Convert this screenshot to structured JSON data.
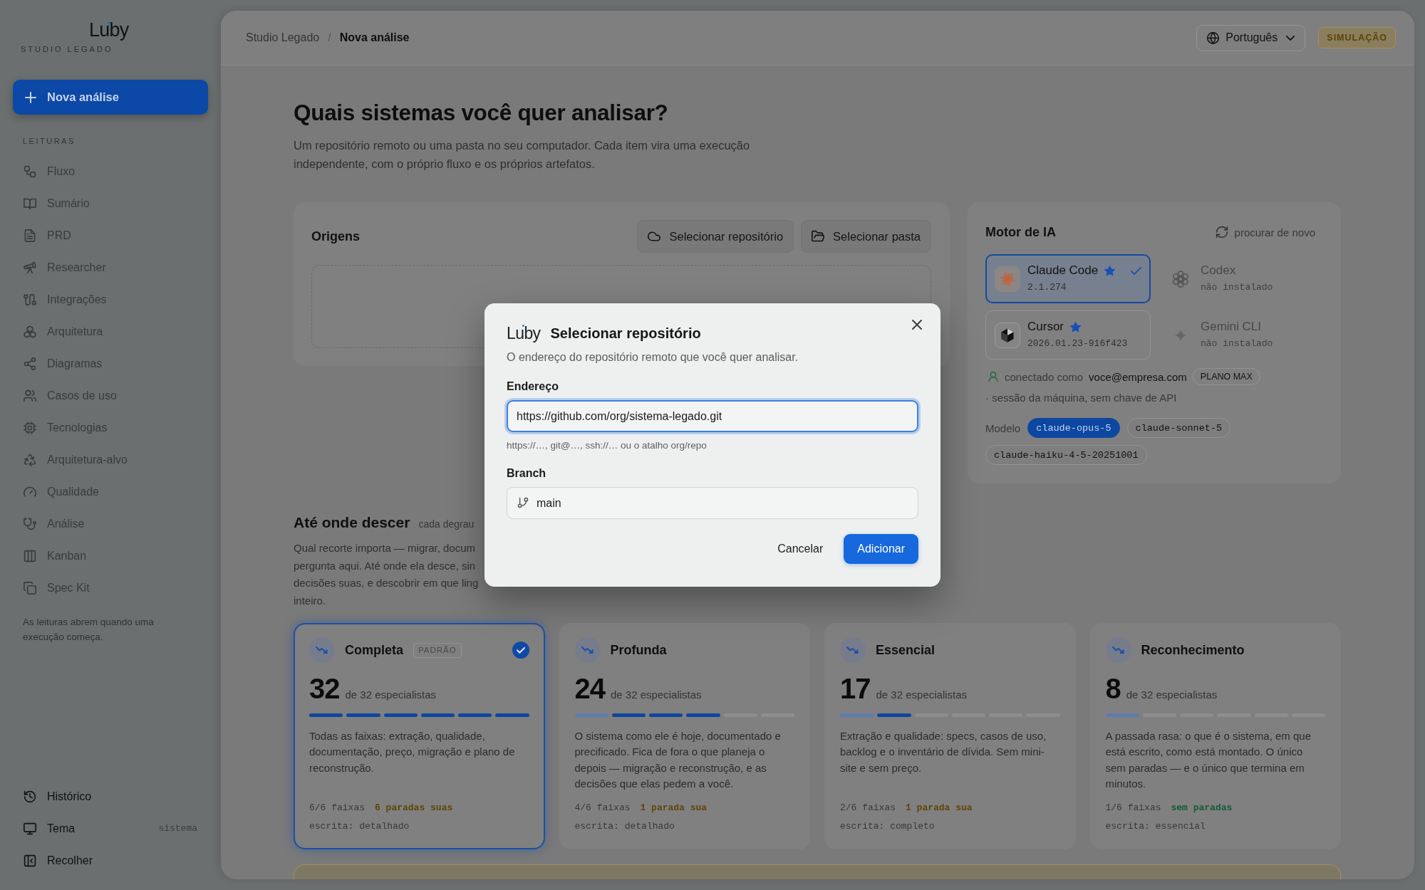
{
  "sidebar": {
    "logo": "Luby",
    "subtitle": "STUDIO LEGADO",
    "new_button": "Nova análise",
    "section_label": "LEITURAS",
    "items": [
      {
        "label": "Fluxo",
        "disabled": true
      },
      {
        "label": "Sumário",
        "disabled": true
      },
      {
        "label": "PRD",
        "disabled": true
      },
      {
        "label": "Researcher",
        "disabled": true
      },
      {
        "label": "Integrações",
        "disabled": true
      },
      {
        "label": "Arquitetura",
        "disabled": true
      },
      {
        "label": "Diagramas",
        "disabled": true
      },
      {
        "label": "Casos de uso",
        "disabled": true
      },
      {
        "label": "Tecnologias",
        "disabled": true
      },
      {
        "label": "Arquitetura-alvo",
        "disabled": true
      },
      {
        "label": "Qualidade",
        "disabled": true
      },
      {
        "label": "Análise",
        "disabled": true
      },
      {
        "label": "Kanban",
        "disabled": true
      },
      {
        "label": "Spec Kit",
        "disabled": true
      }
    ],
    "note": "As leituras abrem quando uma execução começa.",
    "footer_items": [
      {
        "label": "Histórico"
      },
      {
        "label": "Tema",
        "value": "sistema"
      },
      {
        "label": "Recolher"
      }
    ]
  },
  "header": {
    "breadcrumb": [
      {
        "label": "Studio Legado",
        "current": false
      },
      {
        "label": "Nova análise",
        "current": true
      }
    ],
    "separator": "/",
    "language": "Português",
    "mode_badge": "SIMULAÇÃO"
  },
  "intro": {
    "title": "Quais sistemas você quer analisar?",
    "description": "Um repositório remoto ou uma pasta no seu computador. Cada item vira uma execução independente, com o próprio fluxo e os próprios artefatos."
  },
  "origins": {
    "title": "Origens",
    "buttons": [
      "Selecionar repositório",
      "Selecionar pasta"
    ]
  },
  "engine": {
    "title": "Motor de IA",
    "rescan": "procurar de novo",
    "engines": [
      {
        "name": "Claude Code",
        "detail": "2.1.274",
        "installed": true,
        "starred": true,
        "selected": true
      },
      {
        "name": "Codex",
        "detail": "não instalado",
        "installed": false,
        "starred": false,
        "selected": false
      },
      {
        "name": "Cursor",
        "detail": "2026.01.23-916f423",
        "installed": true,
        "starred": true,
        "selected": false
      },
      {
        "name": "Gemini CLI",
        "detail": "não instalado",
        "installed": false,
        "starred": false,
        "selected": false
      }
    ],
    "account": {
      "prefix": "conectado como",
      "email": "voce@empresa.com",
      "plan": "PLANO MAX",
      "note": "· sessão da máquina, sem chave de API"
    },
    "model_label": "Modelo",
    "models": [
      {
        "name": "claude-opus-5",
        "selected": true
      },
      {
        "name": "claude-sonnet-5",
        "selected": false
      },
      {
        "name": "claude-haiku-4-5-20251001",
        "selected": false
      }
    ]
  },
  "depth": {
    "title": "Até onde descer",
    "hint": "cada degrau",
    "description_lines": [
      "Qual recorte importa — migrar, docum",
      "pergunta aqui. Até onde ela desce, sin",
      "decisões suas, e descobrir em que ling",
      "inteiro."
    ],
    "levels": [
      {
        "name": "Completa",
        "badge": "PADRÃO",
        "selected": true,
        "count": "32",
        "total": "de 32 especialistas",
        "segments": [
          {
            "color": "#0f469f"
          },
          {
            "color": "#0f469f"
          },
          {
            "color": "#0f469f"
          },
          {
            "color": "#0f469f"
          },
          {
            "color": "#0f469f"
          },
          {
            "color": "#0f469f"
          }
        ],
        "description": "Todas as faixas: extração, qualidade, documentação, preço, migração e plano de reconstrução.",
        "lanes": "6/6 faixas",
        "stops": {
          "text": "6 paradas suas",
          "color": "#5e4508"
        },
        "writing": "escrita: detalhado"
      },
      {
        "name": "Profunda",
        "selected": false,
        "count": "24",
        "total": "de 32 especialistas",
        "segments": [
          {
            "color": "#5d7cad"
          },
          {
            "color": "#0f469f"
          },
          {
            "color": "#0f469f"
          },
          {
            "color": "#0f469f"
          },
          {
            "color": "#8e8e8e"
          },
          {
            "color": "#8e8e8e"
          }
        ],
        "description": "O sistema como ele é hoje, documentado e precificado. Fica de fora o que planeja o depois — migração e reconstrução, e as decisões que elas pedem a você.",
        "lanes": "4/6 faixas",
        "stops": {
          "text": "1 parada sua",
          "color": "#5e4508"
        },
        "writing": "escrita: detalhado"
      },
      {
        "name": "Essencial",
        "selected": false,
        "count": "17",
        "total": "de 32 especialistas",
        "segments": [
          {
            "color": "#5d7cad"
          },
          {
            "color": "#0f469f"
          },
          {
            "color": "#8e8e8e"
          },
          {
            "color": "#8e8e8e"
          },
          {
            "color": "#8e8e8e"
          },
          {
            "color": "#8e8e8e"
          }
        ],
        "description": "Extração e qualidade: specs, casos de uso, backlog e o inventário de dívida. Sem mini-site e sem preço.",
        "lanes": "2/6 faixas",
        "stops": {
          "text": "1 parada sua",
          "color": "#5e4508"
        },
        "writing": "escrita: completo"
      },
      {
        "name": "Reconhecimento",
        "selected": false,
        "count": "8",
        "total": "de 32 especialistas",
        "segments": [
          {
            "color": "#5d7cad"
          },
          {
            "color": "#8e8e8e"
          },
          {
            "color": "#8e8e8e"
          },
          {
            "color": "#8e8e8e"
          },
          {
            "color": "#8e8e8e"
          },
          {
            "color": "#8e8e8e"
          }
        ],
        "description": "A passada rasa: o que é o sistema, em que está escrito, como está montado. O único sem paradas — e o único que termina em minutos.",
        "lanes": "1/6 faixas",
        "stops": {
          "text": "sem paradas",
          "color": "#135a37"
        },
        "writing": "escrita: essencial"
      }
    ]
  },
  "dialog": {
    "logo": "Luby",
    "title": "Selecionar repositório",
    "description": "O endereço do repositório remoto que você quer analisar.",
    "fields": [
      {
        "kind": "text",
        "label": "Endereço",
        "value": "https://github.com/org/sistema-legado.git",
        "hint": "https://…, git@…, ssh://… ou o atalho org/repo",
        "focused": true
      },
      {
        "kind": "branch",
        "label": "Branch",
        "value": "main",
        "focused": false
      }
    ],
    "buttons": [
      {
        "label": "Cancelar",
        "kind": "secondary"
      },
      {
        "label": "Adicionar",
        "kind": "primary"
      }
    ]
  }
}
